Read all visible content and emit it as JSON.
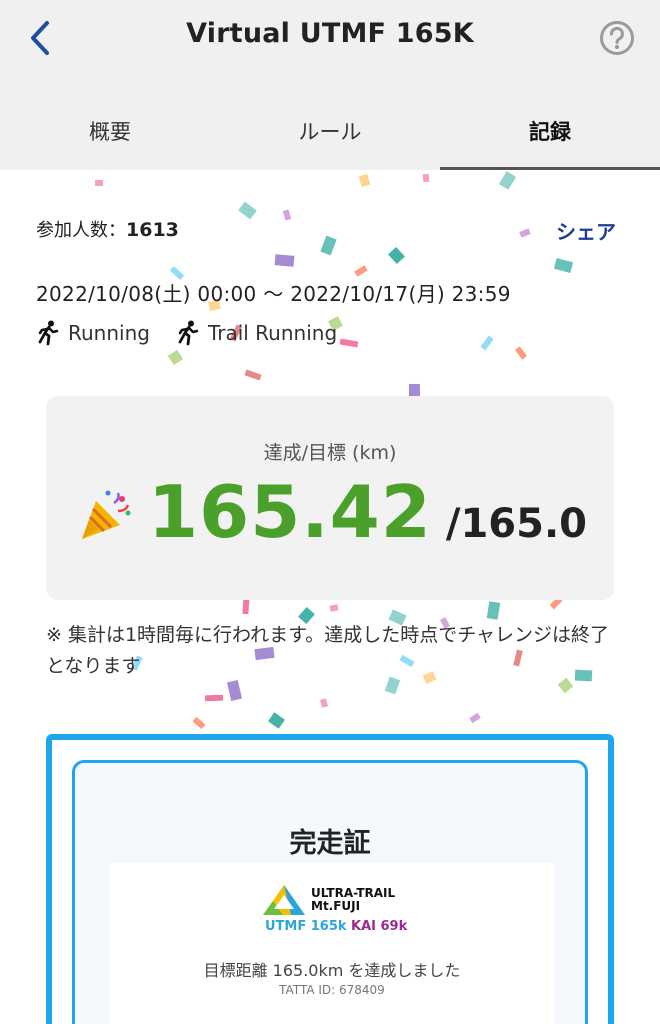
{
  "header": {
    "title": "Virtual UTMF 165K",
    "back_icon": "chevron-left-icon",
    "help_icon": "question-circle-icon"
  },
  "tabs": [
    {
      "label": "概要",
      "active": false
    },
    {
      "label": "ルール",
      "active": false
    },
    {
      "label": "記録",
      "active": true
    }
  ],
  "info": {
    "participants_label": "参加人数：",
    "participants_count": "1613",
    "share_label": "シェア",
    "period": "2022/10/08(土) 00:00 〜 2022/10/17(月) 23:59",
    "activities": [
      "Running",
      "Trail Running"
    ]
  },
  "progress": {
    "label": "達成/目標 (km)",
    "achieved": "165.42",
    "goal": "/165.0",
    "icon": "party-popper-icon"
  },
  "note": "※ 集計は1時間毎に行われます。達成した時点でチャレンジは終了となります",
  "certificate": {
    "title": "完走証",
    "logo_line1": "ULTRA-TRAIL",
    "logo_line2": "Mt.FUJI",
    "logo_utmf": "UTMF 165k",
    "logo_kai": "KAI 69k",
    "achievement": "目標距離 165.0km を達成しました",
    "id": "TATTA ID: 678409"
  },
  "colors": {
    "accent_blue": "#1fa6ef",
    "achieved_green": "#4aa02a",
    "share_blue": "#1b3f93"
  }
}
